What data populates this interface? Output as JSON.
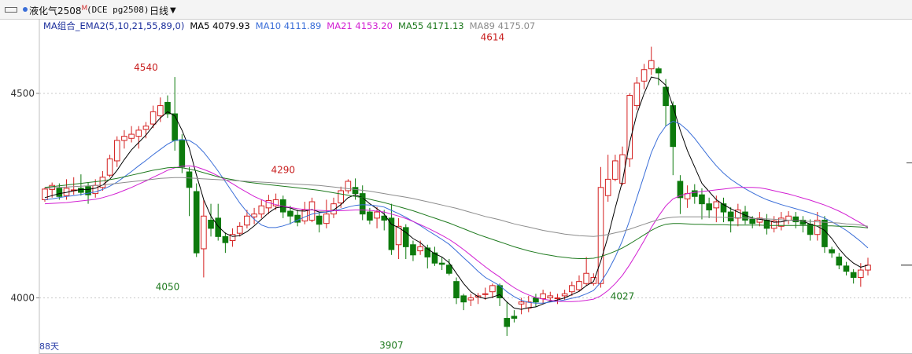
{
  "toolbar": {
    "instrument_name": "液化气2508",
    "instrument_flag": "M",
    "instrument_code": "(DCE pg2508)",
    "period": "日线",
    "menu_icon": "window-icon",
    "dropdown_icon": "chevron-down-icon"
  },
  "indicator": {
    "label": "MA组合_EMA2(5,10,21,55,89,0)",
    "items": [
      {
        "label": "MA5 4079.93",
        "color": "#000000"
      },
      {
        "label": "MA10 4111.89",
        "color": "#3a6ed8"
      },
      {
        "label": "MA21 4153.20",
        "color": "#d21fd2"
      },
      {
        "label": "MA55 4171.13",
        "color": "#1f7a1f"
      },
      {
        "label": "MA89 4175.07",
        "color": "#8c8c8c"
      }
    ]
  },
  "footer": {
    "day_count": "88天"
  },
  "chart_data": {
    "type": "candlestick",
    "ylim": [
      3905,
      4640
    ],
    "y_ticks": [
      4000,
      4500
    ],
    "annotations": [
      {
        "label": "4540",
        "index": 14,
        "value": 4540,
        "position": "above"
      },
      {
        "label": "4050",
        "index": 17,
        "value": 4050,
        "position": "below"
      },
      {
        "label": "4290",
        "index": 33,
        "value": 4290,
        "position": "above"
      },
      {
        "label": "3907",
        "index": 48,
        "value": 3907,
        "position": "below"
      },
      {
        "label": "4614",
        "index": 62,
        "value": 4614,
        "position": "above"
      },
      {
        "label": "4027",
        "index": 80,
        "value": 4027,
        "position": "below"
      }
    ],
    "candles": [
      [
        4240,
        4266,
        4270,
        4235
      ],
      [
        4265,
        4275,
        4282,
        4245
      ],
      [
        4268,
        4248,
        4280,
        4240
      ],
      [
        4250,
        4268,
        4290,
        4240
      ],
      [
        4262,
        4264,
        4295,
        4252
      ],
      [
        4268,
        4258,
        4302,
        4250
      ],
      [
        4272,
        4252,
        4282,
        4230
      ],
      [
        4255,
        4275,
        4290,
        4245
      ],
      [
        4270,
        4295,
        4310,
        4262
      ],
      [
        4300,
        4340,
        4350,
        4295
      ],
      [
        4335,
        4385,
        4395,
        4320
      ],
      [
        4385,
        4395,
        4410,
        4365
      ],
      [
        4390,
        4400,
        4420,
        4380
      ],
      [
        4395,
        4410,
        4420,
        4365
      ],
      [
        4412,
        4420,
        4430,
        4390
      ],
      [
        4425,
        4455,
        4470,
        4415
      ],
      [
        4445,
        4470,
        4490,
        4430
      ],
      [
        4478,
        4450,
        4495,
        4440
      ],
      [
        4450,
        4385,
        4540,
        4360
      ],
      [
        4385,
        4320,
        4400,
        4305
      ],
      [
        4308,
        4270,
        4320,
        4200
      ],
      [
        4260,
        4110,
        4280,
        4100
      ],
      [
        4120,
        4200,
        4240,
        4050
      ],
      [
        4190,
        4170,
        4230,
        4150
      ],
      [
        4195,
        4150,
        4230,
        4140
      ],
      [
        4150,
        4135,
        4160,
        4110
      ],
      [
        4140,
        4155,
        4170,
        4125
      ],
      [
        4158,
        4175,
        4185,
        4150
      ],
      [
        4178,
        4200,
        4215,
        4170
      ],
      [
        4198,
        4205,
        4220,
        4180
      ],
      [
        4205,
        4225,
        4240,
        4195
      ],
      [
        4220,
        4238,
        4252,
        4205
      ],
      [
        4225,
        4240,
        4255,
        4215
      ],
      [
        4240,
        4210,
        4250,
        4195
      ],
      [
        4212,
        4200,
        4225,
        4180
      ],
      [
        4202,
        4185,
        4215,
        4175
      ],
      [
        4188,
        4215,
        4235,
        4180
      ],
      [
        4190,
        4235,
        4245,
        4185
      ],
      [
        4200,
        4180,
        4210,
        4160
      ],
      [
        4182,
        4205,
        4240,
        4170
      ],
      [
        4205,
        4230,
        4245,
        4195
      ],
      [
        4232,
        4262,
        4272,
        4220
      ],
      [
        4262,
        4285,
        4290,
        4255
      ],
      [
        4270,
        4255,
        4292,
        4240
      ],
      [
        4255,
        4205,
        4275,
        4190
      ],
      [
        4210,
        4190,
        4220,
        4180
      ],
      [
        4195,
        4210,
        4222,
        4170
      ],
      [
        4200,
        4190,
        4215,
        4165
      ],
      [
        4195,
        4118,
        4230,
        4105
      ],
      [
        4130,
        4175,
        4195,
        4095
      ],
      [
        4172,
        4125,
        4180,
        4095
      ],
      [
        4130,
        4105,
        4140,
        4090
      ],
      [
        4115,
        4125,
        4140,
        4105
      ],
      [
        4122,
        4100,
        4130,
        4072
      ],
      [
        4110,
        4085,
        4125,
        4078
      ],
      [
        4085,
        4082,
        4100,
        4068
      ],
      [
        4080,
        4060,
        4095,
        4055
      ],
      [
        4040,
        4000,
        4050,
        3985
      ],
      [
        4005,
        3990,
        4010,
        3970
      ],
      [
        3995,
        4000,
        4010,
        3980
      ],
      [
        4002,
        4005,
        4012,
        3985
      ],
      [
        4010,
        4010,
        4025,
        3995
      ],
      [
        4015,
        4030,
        4035,
        4000
      ],
      [
        4030,
        4000,
        4035,
        3980
      ],
      [
        3950,
        3930,
        3990,
        3907
      ],
      [
        3955,
        3950,
        3970,
        3940
      ],
      [
        3985,
        3990,
        4000,
        3960
      ],
      [
        3975,
        3990,
        4005,
        3965
      ],
      [
        4000,
        3990,
        4010,
        3978
      ],
      [
        3998,
        4010,
        4020,
        3985
      ],
      [
        4000,
        4005,
        4015,
        3990
      ],
      [
        4000,
        4000,
        4010,
        3985
      ],
      [
        4005,
        4010,
        4020,
        3995
      ],
      [
        4015,
        4030,
        4040,
        4005
      ],
      [
        4020,
        4040,
        4055,
        4015
      ],
      [
        4035,
        4060,
        4100,
        4030
      ],
      [
        4035,
        4050,
        4060,
        4030
      ],
      [
        4035,
        4270,
        4320,
        4025
      ],
      [
        4250,
        4290,
        4350,
        4235
      ],
      [
        4290,
        4335,
        4350,
        4285
      ],
      [
        4280,
        4350,
        4370,
        4275
      ],
      [
        4340,
        4495,
        4500,
        4320
      ],
      [
        4470,
        4525,
        4540,
        4460
      ],
      [
        4530,
        4558,
        4572,
        4510
      ],
      [
        4560,
        4580,
        4614,
        4545
      ],
      [
        4560,
        4550,
        4565,
        4520
      ],
      [
        4515,
        4470,
        4535,
        4420
      ],
      [
        4470,
        4370,
        4480,
        4300
      ],
      [
        4285,
        4245,
        4300,
        4205
      ],
      [
        4242,
        4255,
        4275,
        4220
      ],
      [
        4262,
        4248,
        4278,
        4230
      ],
      [
        4252,
        4230,
        4268,
        4192
      ],
      [
        4230,
        4215,
        4245,
        4195
      ],
      [
        4220,
        4235,
        4250,
        4185
      ],
      [
        4230,
        4210,
        4245,
        4185
      ],
      [
        4210,
        4188,
        4222,
        4160
      ],
      [
        4195,
        4215,
        4230,
        4175
      ],
      [
        4210,
        4190,
        4225,
        4180
      ],
      [
        4192,
        4182,
        4200,
        4170
      ],
      [
        4185,
        4195,
        4210,
        4175
      ],
      [
        4190,
        4170,
        4205,
        4155
      ],
      [
        4170,
        4188,
        4200,
        4160
      ],
      [
        4175,
        4195,
        4210,
        4165
      ],
      [
        4190,
        4200,
        4212,
        4180
      ],
      [
        4198,
        4186,
        4210,
        4170
      ],
      [
        4190,
        4180,
        4200,
        4160
      ],
      [
        4180,
        4155,
        4192,
        4140
      ],
      [
        4155,
        4190,
        4210,
        4140
      ],
      [
        4190,
        4125,
        4200,
        4110
      ],
      [
        4118,
        4110,
        4125,
        4098
      ],
      [
        4100,
        4080,
        4110,
        4070
      ],
      [
        4078,
        4065,
        4088,
        4055
      ],
      [
        4062,
        4050,
        4070,
        4035
      ],
      [
        4050,
        4068,
        4085,
        4027
      ],
      [
        4068,
        4080,
        4098,
        4055
      ]
    ],
    "ma_lines": [
      {
        "name": "MA5",
        "color": "#000000",
        "values": [
          4245,
          4250,
          4255,
          4258,
          4262,
          4265,
          4265,
          4268,
          4276,
          4290,
          4312,
          4338,
          4362,
          4380,
          4398,
          4420,
          4440,
          4455,
          4445,
          4410,
          4366,
          4300,
          4240,
          4200,
          4175,
          4158,
          4150,
          4152,
          4162,
          4176,
          4192,
          4208,
          4220,
          4223,
          4220,
          4213,
          4212,
          4216,
          4210,
          4210,
          4215,
          4228,
          4245,
          4252,
          4245,
          4230,
          4218,
          4205,
          4180,
          4172,
          4160,
          4145,
          4135,
          4120,
          4108,
          4100,
          4086,
          4060,
          4035,
          4015,
          4003,
          3998,
          4002,
          4008,
          3990,
          3975,
          3972,
          3976,
          3978,
          3985,
          3992,
          3995,
          4000,
          4008,
          4016,
          4030,
          4040,
          4090,
          4150,
          4220,
          4285,
          4380,
          4450,
          4500,
          4540,
          4536,
          4520,
          4468,
          4410,
          4360,
          4320,
          4280,
          4260,
          4240,
          4228,
          4218,
          4210,
          4202,
          4195,
          4192,
          4190,
          4185,
          4186,
          4190,
          4190,
          4188,
          4180,
          4175,
          4165,
          4145,
          4120,
          4100,
          4085,
          4075,
          4080
        ]
      },
      {
        "name": "MA10",
        "color": "#3a6ed8",
        "values": [
          4240,
          4242,
          4245,
          4248,
          4250,
          4253,
          4256,
          4259,
          4265,
          4273,
          4283,
          4296,
          4309,
          4323,
          4336,
          4350,
          4363,
          4376,
          4385,
          4387,
          4385,
          4374,
          4356,
          4334,
          4310,
          4284,
          4258,
          4232,
          4210,
          4192,
          4178,
          4172,
          4172,
          4176,
          4182,
          4190,
          4198,
          4205,
          4208,
          4210,
          4213,
          4217,
          4222,
          4226,
          4228,
          4227,
          4225,
          4222,
          4214,
          4206,
          4197,
          4187,
          4177,
          4165,
          4154,
          4143,
          4131,
          4115,
          4098,
          4082,
          4065,
          4050,
          4040,
          4030,
          4015,
          4003,
          3994,
          3989,
          3987,
          3987,
          3990,
          3992,
          3995,
          3999,
          4003,
          4010,
          4018,
          4038,
          4066,
          4100,
          4140,
          4190,
          4245,
          4300,
          4355,
          4395,
          4420,
          4432,
          4425,
          4410,
          4390,
          4367,
          4344,
          4323,
          4305,
          4290,
          4278,
          4267,
          4257,
          4248,
          4240,
          4234,
          4228,
          4223,
          4218,
          4213,
          4208,
          4202,
          4195,
          4186,
          4176,
          4165,
          4152,
          4138,
          4122
        ]
      },
      {
        "name": "MA21",
        "color": "#d21fd2",
        "values": [
          4230,
          4231,
          4232,
          4233,
          4235,
          4237,
          4239,
          4241,
          4245,
          4250,
          4256,
          4263,
          4270,
          4278,
          4286,
          4295,
          4303,
          4312,
          4318,
          4322,
          4323,
          4320,
          4314,
          4307,
          4298,
          4289,
          4279,
          4268,
          4258,
          4248,
          4240,
          4233,
          4228,
          4224,
          4221,
          4218,
          4216,
          4215,
          4214,
          4213,
          4213,
          4213,
          4214,
          4215,
          4215,
          4214,
          4212,
          4210,
          4205,
          4200,
          4194,
          4187,
          4179,
          4171,
          4162,
          4153,
          4143,
          4131,
          4118,
          4104,
          4090,
          4076,
          4063,
          4051,
          4037,
          4025,
          4015,
          4007,
          4001,
          3997,
          3994,
          3992,
          3991,
          3991,
          3992,
          3994,
          3997,
          4005,
          4018,
          4035,
          4055,
          4081,
          4110,
          4140,
          4172,
          4200,
          4225,
          4242,
          4250,
          4255,
          4258,
          4260,
          4262,
          4264,
          4266,
          4268,
          4270,
          4270,
          4270,
          4269,
          4266,
          4262,
          4258,
          4254,
          4249,
          4244,
          4239,
          4233,
          4227,
          4220,
          4212,
          4203,
          4193,
          4183,
          4172
        ]
      },
      {
        "name": "MA55",
        "color": "#1f7a1f",
        "values": [
          4270,
          4272,
          4274,
          4276,
          4278,
          4280,
          4282,
          4284,
          4286,
          4289,
          4292,
          4296,
          4300,
          4304,
          4308,
          4312,
          4315,
          4318,
          4319,
          4318,
          4315,
          4311,
          4306,
          4301,
          4296,
          4292,
          4289,
          4286,
          4283,
          4281,
          4279,
          4277,
          4275,
          4273,
          4271,
          4269,
          4267,
          4265,
          4263,
          4260,
          4257,
          4254,
          4251,
          4248,
          4245,
          4241,
          4237,
          4233,
          4228,
          4223,
          4218,
          4213,
          4207,
          4201,
          4195,
          4189,
          4183,
          4176,
          4169,
          4162,
          4155,
          4149,
          4143,
          4137,
          4131,
          4125,
          4120,
          4115,
          4111,
          4107,
          4104,
          4101,
          4099,
          4097,
          4096,
          4096,
          4097,
          4101,
          4107,
          4114,
          4122,
          4132,
          4143,
          4154,
          4165,
          4174,
          4180,
          4182,
          4182,
          4181,
          4180,
          4180,
          4179,
          4179,
          4179,
          4178,
          4178,
          4178,
          4178,
          4178,
          4177,
          4177,
          4177,
          4177,
          4177,
          4177,
          4177,
          4176,
          4176,
          4176,
          4175,
          4175,
          4174,
          4173,
          4171
        ]
      },
      {
        "name": "MA89",
        "color": "#8c8c8c",
        "values": [
          4268,
          4269,
          4270,
          4271,
          4272,
          4273,
          4274,
          4275,
          4276,
          4278,
          4280,
          4282,
          4284,
          4286,
          4288,
          4290,
          4292,
          4293,
          4294,
          4294,
          4293,
          4292,
          4291,
          4290,
          4289,
          4288,
          4287,
          4286,
          4285,
          4284,
          4283,
          4282,
          4281,
          4280,
          4279,
          4278,
          4277,
          4276,
          4275,
          4273,
          4271,
          4269,
          4267,
          4265,
          4263,
          4261,
          4258,
          4255,
          4252,
          4249,
          4246,
          4243,
          4239,
          4235,
          4231,
          4227,
          4223,
          4219,
          4214,
          4209,
          4204,
          4199,
          4195,
          4191,
          4186,
          4181,
          4177,
          4173,
          4169,
          4165,
          4162,
          4159,
          4156,
          4154,
          4152,
          4151,
          4150,
          4152,
          4155,
          4159,
          4163,
          4168,
          4174,
          4180,
          4186,
          4191,
          4195,
          4197,
          4198,
          4198,
          4198,
          4198,
          4198,
          4197,
          4197,
          4196,
          4196,
          4195,
          4194,
          4194,
          4193,
          4192,
          4191,
          4190,
          4189,
          4188,
          4187,
          4186,
          4185,
          4184,
          4183,
          4181,
          4180,
          4178,
          4175
        ]
      }
    ]
  },
  "colors": {
    "up": "#d42020",
    "down": "#0d7a0d",
    "grid": "#c8c8c8",
    "axis_text": "#333333"
  }
}
